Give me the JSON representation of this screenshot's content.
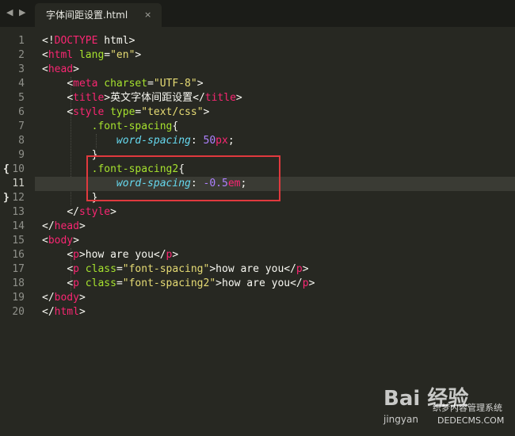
{
  "tab": {
    "title": "字体间距设置.html",
    "close": "×"
  },
  "nav": {
    "back": "◀",
    "forward": "▶"
  },
  "current_line": 11,
  "lines": [
    {
      "n": "1",
      "tokens": [
        [
          "t-pun",
          "<!"
        ],
        [
          "t-kw",
          "DOCTYPE"
        ],
        [
          "t-doc",
          " html"
        ],
        [
          "t-pun",
          ">"
        ]
      ]
    },
    {
      "n": "2",
      "tokens": [
        [
          "t-pun",
          "<"
        ],
        [
          "t-tag",
          "html"
        ],
        [
          "t-txt",
          " "
        ],
        [
          "t-attr",
          "lang"
        ],
        [
          "t-pun",
          "="
        ],
        [
          "t-str",
          "\"en\""
        ],
        [
          "t-pun",
          ">"
        ]
      ]
    },
    {
      "n": "3",
      "tokens": [
        [
          "t-pun",
          "<"
        ],
        [
          "t-tag",
          "head"
        ],
        [
          "t-pun",
          ">"
        ]
      ]
    },
    {
      "n": "4",
      "tokens": [
        [
          "t-txt",
          "    "
        ],
        [
          "t-pun",
          "<"
        ],
        [
          "t-tag",
          "meta"
        ],
        [
          "t-txt",
          " "
        ],
        [
          "t-attr",
          "charset"
        ],
        [
          "t-pun",
          "="
        ],
        [
          "t-str",
          "\"UTF-8\""
        ],
        [
          "t-pun",
          ">"
        ]
      ]
    },
    {
      "n": "5",
      "tokens": [
        [
          "t-txt",
          "    "
        ],
        [
          "t-pun",
          "<"
        ],
        [
          "t-tag",
          "title"
        ],
        [
          "t-pun",
          ">"
        ],
        [
          "t-txt",
          "英文字体间距设置"
        ],
        [
          "t-pun",
          "</"
        ],
        [
          "t-tag",
          "title"
        ],
        [
          "t-pun",
          ">"
        ]
      ]
    },
    {
      "n": "6",
      "tokens": [
        [
          "t-txt",
          "    "
        ],
        [
          "t-pun",
          "<"
        ],
        [
          "t-tag",
          "style"
        ],
        [
          "t-txt",
          " "
        ],
        [
          "t-attr",
          "type"
        ],
        [
          "t-pun",
          "="
        ],
        [
          "t-str",
          "\"text/css\""
        ],
        [
          "t-pun",
          ">"
        ]
      ]
    },
    {
      "n": "7",
      "tokens": [
        [
          "t-txt",
          "        "
        ],
        [
          "t-sel",
          ".font-spacing"
        ],
        [
          "t-pun",
          "{"
        ]
      ]
    },
    {
      "n": "8",
      "tokens": [
        [
          "t-txt",
          "            "
        ],
        [
          "t-prop",
          "word-spacing"
        ],
        [
          "t-pun",
          ": "
        ],
        [
          "t-num",
          "50"
        ],
        [
          "t-unit",
          "px"
        ],
        [
          "t-pun",
          ";"
        ]
      ]
    },
    {
      "n": "9",
      "tokens": [
        [
          "t-txt",
          "        "
        ],
        [
          "t-pun",
          "}"
        ]
      ]
    },
    {
      "n": "10",
      "fold": "{",
      "tokens": [
        [
          "t-txt",
          "        "
        ],
        [
          "t-sel",
          ".font-spacing2"
        ],
        [
          "t-pun",
          "{"
        ]
      ]
    },
    {
      "n": "11",
      "tokens": [
        [
          "t-txt",
          "            "
        ],
        [
          "t-prop",
          "word-spacing"
        ],
        [
          "t-pun",
          ": "
        ],
        [
          "t-num",
          "-0.5"
        ],
        [
          "t-unit",
          "em"
        ],
        [
          "t-pun",
          ";"
        ]
      ]
    },
    {
      "n": "12",
      "fold": "}",
      "tokens": [
        [
          "t-txt",
          "        "
        ],
        [
          "t-pun",
          "}"
        ]
      ]
    },
    {
      "n": "13",
      "tokens": [
        [
          "t-txt",
          "    "
        ],
        [
          "t-pun",
          "</"
        ],
        [
          "t-tag",
          "style"
        ],
        [
          "t-pun",
          ">"
        ]
      ]
    },
    {
      "n": "14",
      "tokens": [
        [
          "t-pun",
          "</"
        ],
        [
          "t-tag",
          "head"
        ],
        [
          "t-pun",
          ">"
        ]
      ]
    },
    {
      "n": "15",
      "tokens": [
        [
          "t-pun",
          "<"
        ],
        [
          "t-tag",
          "body"
        ],
        [
          "t-pun",
          ">"
        ]
      ]
    },
    {
      "n": "16",
      "tokens": [
        [
          "t-txt",
          "    "
        ],
        [
          "t-pun",
          "<"
        ],
        [
          "t-tag",
          "p"
        ],
        [
          "t-pun",
          ">"
        ],
        [
          "t-txt",
          "how are you"
        ],
        [
          "t-pun",
          "</"
        ],
        [
          "t-tag",
          "p"
        ],
        [
          "t-pun",
          ">"
        ]
      ]
    },
    {
      "n": "17",
      "tokens": [
        [
          "t-txt",
          "    "
        ],
        [
          "t-pun",
          "<"
        ],
        [
          "t-tag",
          "p"
        ],
        [
          "t-txt",
          " "
        ],
        [
          "t-attr",
          "class"
        ],
        [
          "t-pun",
          "="
        ],
        [
          "t-str",
          "\"font-spacing\""
        ],
        [
          "t-pun",
          ">"
        ],
        [
          "t-txt",
          "how are you"
        ],
        [
          "t-pun",
          "</"
        ],
        [
          "t-tag",
          "p"
        ],
        [
          "t-pun",
          ">"
        ]
      ]
    },
    {
      "n": "18",
      "tokens": [
        [
          "t-txt",
          "    "
        ],
        [
          "t-pun",
          "<"
        ],
        [
          "t-tag",
          "p"
        ],
        [
          "t-txt",
          " "
        ],
        [
          "t-attr",
          "class"
        ],
        [
          "t-pun",
          "="
        ],
        [
          "t-str",
          "\"font-spacing2\""
        ],
        [
          "t-pun",
          ">"
        ],
        [
          "t-txt",
          "how are you"
        ],
        [
          "t-pun",
          "</"
        ],
        [
          "t-tag",
          "p"
        ],
        [
          "t-pun",
          ">"
        ]
      ]
    },
    {
      "n": "19",
      "tokens": [
        [
          "t-pun",
          "</"
        ],
        [
          "t-tag",
          "body"
        ],
        [
          "t-pun",
          ">"
        ]
      ]
    },
    {
      "n": "20",
      "tokens": [
        [
          "t-pun",
          "</"
        ],
        [
          "t-tag",
          "html"
        ],
        [
          "t-pun",
          ">"
        ]
      ]
    }
  ],
  "colors": {
    "background": "#272822",
    "tag": "#f92672",
    "attribute": "#a6e22e",
    "string": "#e6db74",
    "property": "#66d9ef",
    "number": "#ae81ff",
    "highlight_box": "#e0393e"
  },
  "watermark": {
    "logo": "Bai 经验",
    "sub": "jingyan",
    "site": "织梦内容管理系统",
    "domain": "DEDECMS.COM"
  }
}
